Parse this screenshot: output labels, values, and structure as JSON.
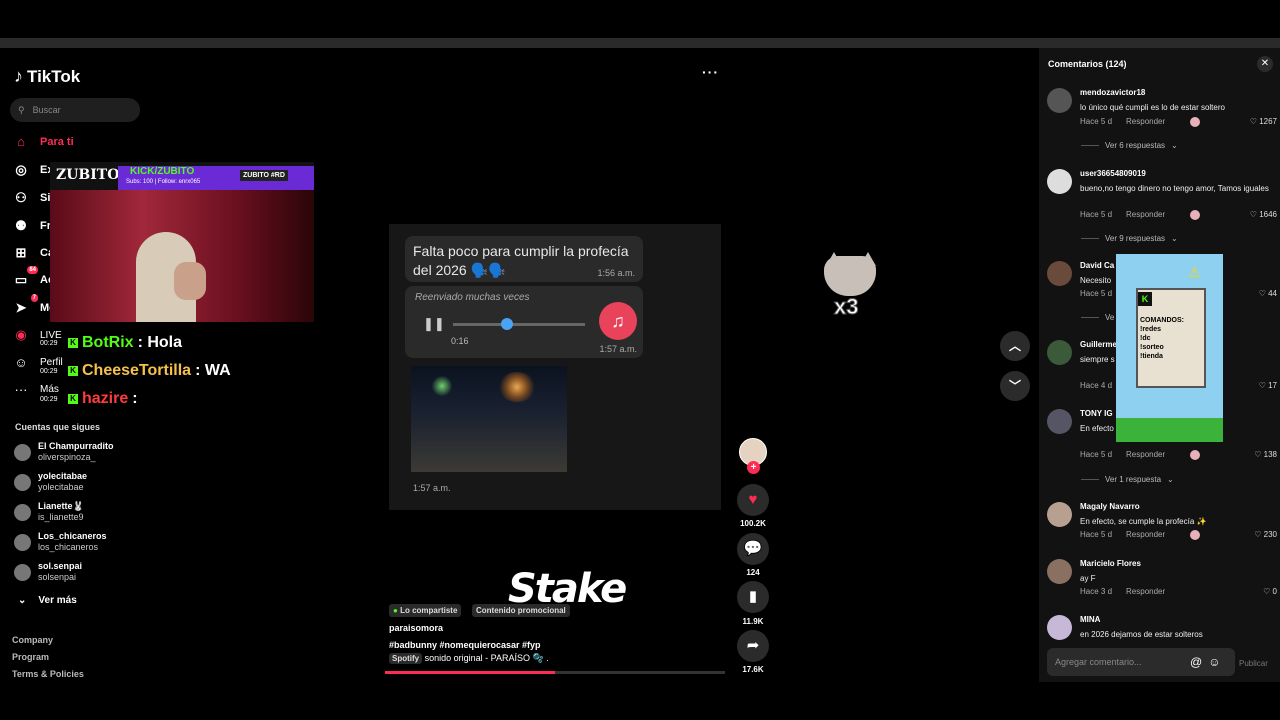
{
  "app": {
    "name": "TikTok"
  },
  "search": {
    "placeholder": "Buscar"
  },
  "nav": [
    {
      "label": "Para ti",
      "icon": "home-icon"
    },
    {
      "label": "Ex",
      "icon": "compass-icon"
    },
    {
      "label": "Si",
      "icon": "user-plus-icon"
    },
    {
      "label": "Fri",
      "icon": "friends-icon"
    },
    {
      "label": "Ca",
      "icon": "upload-icon"
    },
    {
      "label": "Ac",
      "icon": "inbox-icon",
      "badge": "84"
    },
    {
      "label": "Me",
      "icon": "send-icon",
      "badge": "7"
    },
    {
      "label": "LIVE",
      "icon": "live-icon"
    },
    {
      "label": "Perfil",
      "icon": "profile-icon"
    },
    {
      "label": "Más",
      "icon": "more-icon"
    }
  ],
  "stream": {
    "channel": "ZUBITO",
    "kick_handle": "KICK/ZUBITO",
    "subs": "Subs: 100 | Follow: enrx065",
    "command_tag": "ZUBITO #RD"
  },
  "chat": [
    {
      "time": "00:29",
      "user": "BotRix",
      "message": ": Hola",
      "color": "#53fc18"
    },
    {
      "time": "00:29",
      "user": "CheeseTortilla",
      "message": ": WA",
      "color": "#f5c14b"
    },
    {
      "time": "00:29",
      "user": "hazire",
      "message": ":",
      "color": "#ff3b3b"
    }
  ],
  "following": {
    "heading": "Cuentas que sigues",
    "accounts": [
      {
        "name": "El Champurradito",
        "user": "oliverspinoza_"
      },
      {
        "name": "yolecitabae",
        "user": "yolecitabae"
      },
      {
        "name": "Lianette🐰",
        "user": "is_lianette9"
      },
      {
        "name": "Los_chicaneros",
        "user": "los_chicaneros"
      },
      {
        "name": "sol.senpai",
        "user": "solsenpai"
      }
    ],
    "see_more": "Ver más"
  },
  "footer": [
    "Company",
    "Program",
    "Terms & Policies"
  ],
  "video": {
    "msg1_text": "Falta poco para cumplir la profecía del  2026 🗣️🗣️",
    "msg1_time": "1:56 a.m.",
    "forwarded": "Reenviado muchas veces",
    "audio_duration": "0:16",
    "msg2_time": "1:57 a.m.",
    "msg3_time": "1:57 a.m.",
    "sponsor_logo": "Stake",
    "tag1": "Lo compartiste",
    "tag2": "Contenido promocional",
    "author": "paraisomora",
    "hashtags": "#badbunny  #nomequierocasar  #fyp",
    "sound_source": "Spotify",
    "sound": "sonido original - PARAÍSO 🫧 .",
    "progress": 0.5
  },
  "actions": {
    "likes": "100.2K",
    "comments": "124",
    "saves": "11.9K",
    "shares": "17.6K"
  },
  "cat_overlay": {
    "text": "x3"
  },
  "comments_panel": {
    "title": "Comentarios (124)",
    "reply_label": "Responder",
    "comments": [
      {
        "user": "mendozavictor18",
        "text": "lo único qué cumpli es lo de estar soltero",
        "time": "Hace 5 d",
        "likes": "1267",
        "replies": "Ver 6 respuestas"
      },
      {
        "user": "user36654809019",
        "text": "bueno,no tengo dinero no tengo amor, Tamos iguales",
        "time": "Hace 5 d",
        "likes": "1646",
        "replies": "Ver 9 respuestas"
      },
      {
        "user": "David Ca",
        "text": "Necesito",
        "time": "Hace 5 d",
        "likes": "44",
        "replies": "Ve"
      },
      {
        "user": "Guillerme",
        "text": "siempre s                      profecía, nunca du",
        "time": "Hace 4 d",
        "likes": "17",
        "replies": ""
      },
      {
        "user": "TONY IG",
        "text": "En efecto                      estar soltero jajaja",
        "time": "Hace 5 d",
        "likes": "138",
        "replies": "Ver 1 respuesta"
      },
      {
        "user": "Magaly Navarro",
        "text": "En efecto, se cumple la profecía ✨",
        "time": "Hace 5 d",
        "likes": "230",
        "replies": ""
      },
      {
        "user": "Maricielo Flores",
        "text": "ay F",
        "time": "Hace 3 d",
        "likes": "0",
        "replies": ""
      },
      {
        "user": "MINA",
        "text": "en 2026 dejamos de estar solteros",
        "time": "",
        "likes": "",
        "replies": ""
      }
    ],
    "add_placeholder": "Agregar comentario...",
    "publish": "Publicar"
  },
  "widget": {
    "commands": "COMANDOS:\n!redes\n!dc\n!sorteo\n!tienda"
  }
}
